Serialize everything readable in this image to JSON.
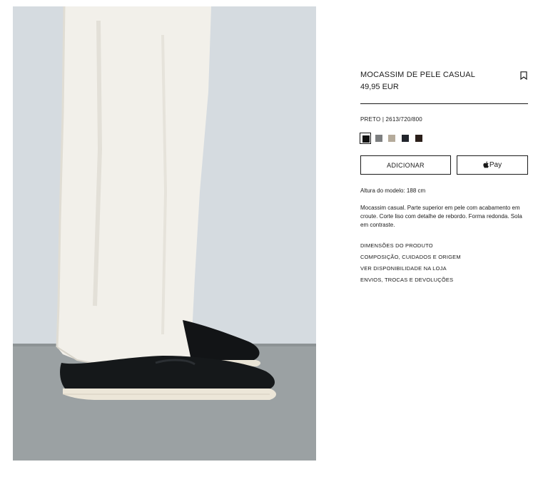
{
  "product": {
    "name": "MOCASSIM DE PELE CASUAL",
    "price": "49,95 EUR",
    "color_ref": "PRETO | 2613/720/800",
    "image_alt": "Mocassim de pele preto com calça branca"
  },
  "icons": {
    "bookmark": "bookmark-icon",
    "apple": "apple-logo-icon"
  },
  "swatches": [
    {
      "color": "#111111",
      "selected": true
    },
    {
      "color": "#7d7f80",
      "selected": false
    },
    {
      "color": "#b5ab9b",
      "selected": false
    },
    {
      "color": "#22252c",
      "selected": false
    },
    {
      "color": "#2b1f1a",
      "selected": false
    }
  ],
  "actions": {
    "add_label": "ADICIONAR",
    "pay_label": "Pay"
  },
  "details": {
    "model_height": "Altura do modelo: 188 cm",
    "description": "Mocassim casual. Parte superior em pele com acabamento em croute. Corte liso com detalhe de rebordo. Forma redonda. Sola em contraste."
  },
  "links": [
    "DIMENSÕES DO PRODUTO",
    "COMPOSIÇÃO, CUIDADOS E ORIGEM",
    "VER DISPONIBILIDADE NA LOJA",
    "ENVIOS, TROCAS E DEVOLUÇÕES"
  ]
}
